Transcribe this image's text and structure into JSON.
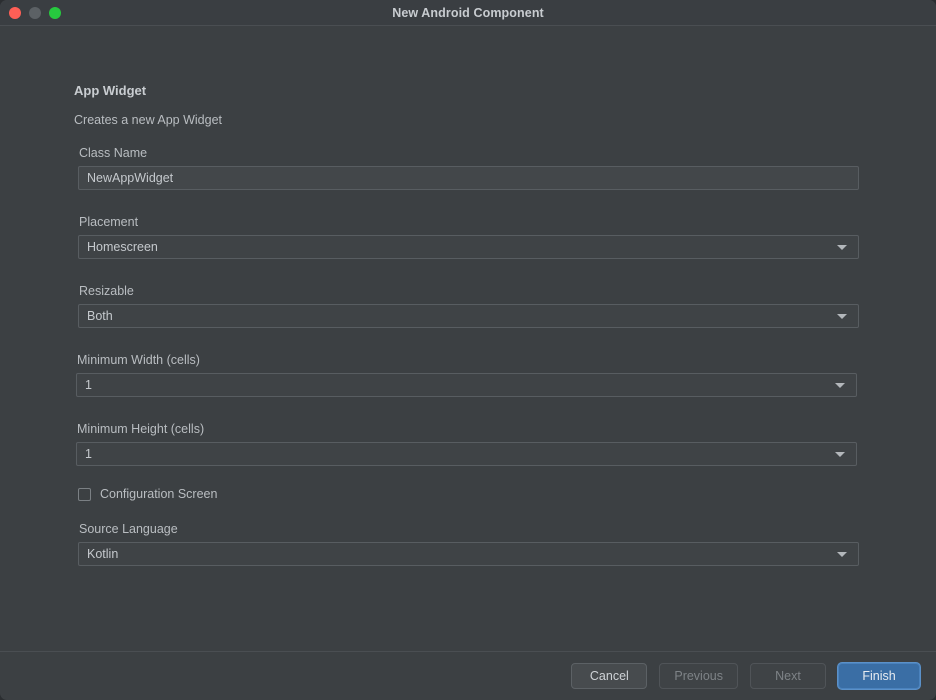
{
  "window": {
    "title": "New Android Component",
    "traffic_lights": [
      {
        "name": "close",
        "color": "#ff5f56"
      },
      {
        "name": "minimize",
        "color": "#5c6165"
      },
      {
        "name": "maximize",
        "color": "#27c93f"
      }
    ]
  },
  "header": {
    "title": "App Widget",
    "subtitle": "Creates a new App Widget"
  },
  "form": {
    "class_name": {
      "label": "Class Name",
      "value": "NewAppWidget",
      "placeholder": ""
    },
    "placement": {
      "label": "Placement",
      "value": "Homescreen"
    },
    "resizable": {
      "label": "Resizable",
      "value": "Both"
    },
    "minimum_width": {
      "label": "Minimum Width (cells)",
      "value": "1"
    },
    "minimum_height": {
      "label": "Minimum Height (cells)",
      "value": "1"
    },
    "configuration_screen": {
      "label": "Configuration Screen",
      "checked": false
    },
    "source_language": {
      "label": "Source Language",
      "value": "Kotlin"
    }
  },
  "footer": {
    "cancel": "Cancel",
    "previous": "Previous",
    "next": "Next",
    "finish": "Finish"
  },
  "icons": {
    "dropdown": "chevron-down-icon"
  },
  "colors": {
    "window_bg": "#3c4043",
    "titlebar_bg": "#3a3e42",
    "primary_button": "#3a6ea5",
    "input_bg": "#43474a",
    "text": "#c5c9cd"
  }
}
